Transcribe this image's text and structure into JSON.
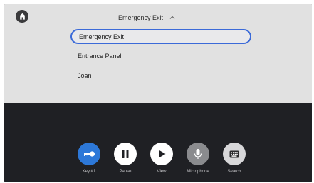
{
  "header": {
    "title": "Emergency Exit",
    "chevron_icon": "chevron-up-icon"
  },
  "home": {
    "icon": "home-icon"
  },
  "list": {
    "items": [
      {
        "label": "Emergency Exit",
        "selected": true
      },
      {
        "label": "Entrance Panel",
        "selected": false
      },
      {
        "label": "Joan",
        "selected": false
      }
    ]
  },
  "controls": [
    {
      "label": "Key #1",
      "icon": "key-icon"
    },
    {
      "label": "Pause",
      "icon": "pause-icon"
    },
    {
      "label": "View",
      "icon": "play-icon"
    },
    {
      "label": "Microphone",
      "icon": "microphone-icon"
    },
    {
      "label": "Search",
      "icon": "keypad-icon"
    }
  ],
  "colors": {
    "panel_bg": "#e1e1e1",
    "dark_bg": "#1f2024",
    "accent_blue": "#2d78d8",
    "selection_border": "#3b6ad8"
  }
}
